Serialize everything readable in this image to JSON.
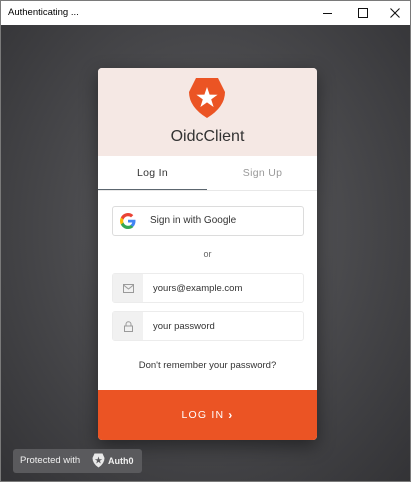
{
  "window": {
    "title": "Authenticating ..."
  },
  "lock": {
    "app_name": "OidcClient",
    "tabs": [
      {
        "label": "Log In",
        "active": true
      },
      {
        "label": "Sign Up",
        "active": false
      }
    ],
    "social_button_label": "Sign in with Google",
    "separator_text": "or",
    "email": {
      "placeholder": "yours@example.com",
      "value": ""
    },
    "password": {
      "placeholder": "your password",
      "value": ""
    },
    "forgot_password_link": "Don't remember your password?",
    "submit_label": "LOG IN",
    "submit_icon": "chevron-right-icon"
  },
  "badge": {
    "text": "Protected with",
    "brand": "Auth0"
  },
  "colors": {
    "accent": "#eb5424",
    "header_bg": "#f5e8e4",
    "backdrop": "#4b4b4e"
  }
}
